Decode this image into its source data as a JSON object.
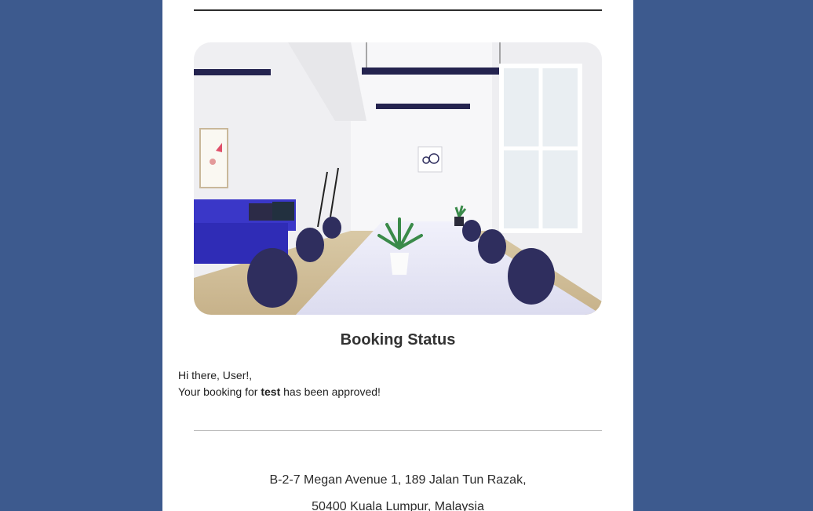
{
  "colors": {
    "page_background": "#3d5a8e",
    "card_background": "#ffffff",
    "sofa": "#3a37c8",
    "chairs": "#2f2e5e",
    "table": "#e6e6f5"
  },
  "hero_image": {
    "subject": "meeting-room-photo"
  },
  "email": {
    "title": "Booking Status",
    "greeting": "Hi there, User!,",
    "message_prefix": "Your booking for ",
    "booking_name": "test",
    "message_suffix": " has been approved!"
  },
  "footer": {
    "address_line1": "B-2-7 Megan Avenue 1, 189 Jalan Tun Razak,",
    "address_line2": "50400 Kuala Lumpur, Malaysia"
  }
}
